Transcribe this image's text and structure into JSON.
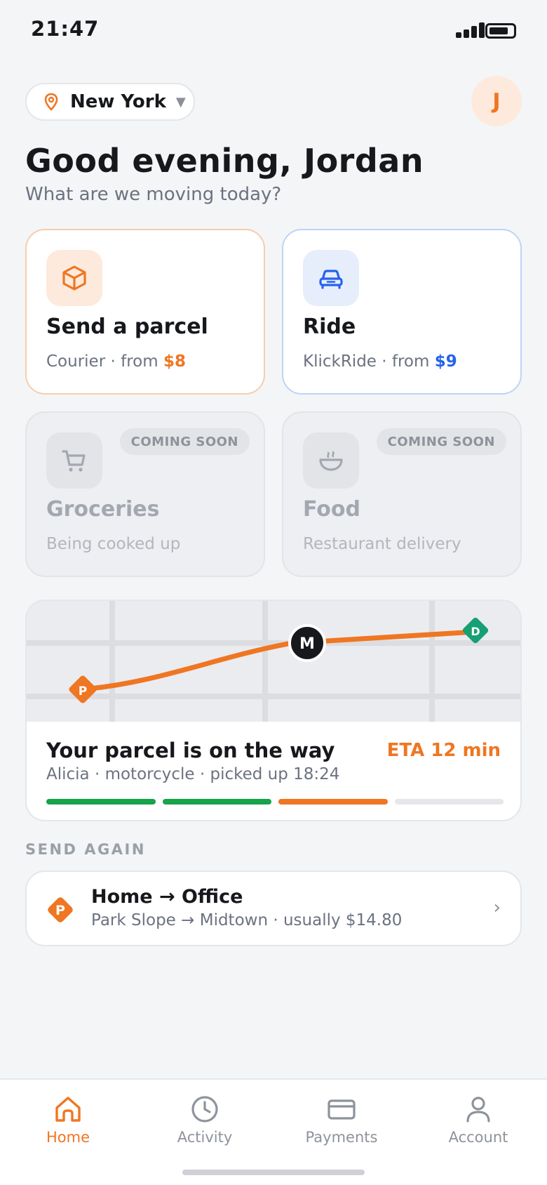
{
  "status": {
    "time": "21:47"
  },
  "header": {
    "city": "New York",
    "avatar_initial": "J"
  },
  "greeting": {
    "title": "Good evening, Jordan",
    "subtitle": "What are we moving today?"
  },
  "services": {
    "parcel": {
      "title": "Send a parcel",
      "sub_prefix": "Courier · from ",
      "price": "$8",
      "icon": "box-icon"
    },
    "ride": {
      "title": "Ride",
      "sub_prefix": "KlickRide · from ",
      "price": "$9",
      "icon": "car-icon"
    },
    "groceries": {
      "title": "Groceries",
      "sub": "Being cooked up",
      "badge": "COMING SOON",
      "icon": "cart-icon"
    },
    "food": {
      "title": "Food",
      "sub": "Restaurant delivery",
      "badge": "COMING SOON",
      "icon": "bowl-icon"
    }
  },
  "tracking": {
    "title": "Your parcel is on the way",
    "eta": "ETA 12 min",
    "sub": "Alicia · motorcycle · picked up 18:24",
    "markers": {
      "pickup": "P",
      "courier": "M",
      "dropoff": "D"
    },
    "progress_steps": [
      "done",
      "done",
      "active",
      "pending"
    ]
  },
  "send_again": {
    "label": "SEND AGAIN",
    "title": "Home → Office",
    "sub": "Park Slope → Midtown · usually $14.80",
    "chevron": "›"
  },
  "tabs": [
    {
      "label": "Home",
      "icon": "home-icon",
      "active": true
    },
    {
      "label": "Activity",
      "icon": "clock-icon",
      "active": false
    },
    {
      "label": "Payments",
      "icon": "card-icon",
      "active": false
    },
    {
      "label": "Account",
      "icon": "person-icon",
      "active": false
    }
  ],
  "colors": {
    "accent": "#ef7622",
    "ride_blue": "#2563eb",
    "done_green": "#16a34a",
    "pending_gray": "#e5e7eb",
    "dropoff_green": "#16a073"
  }
}
